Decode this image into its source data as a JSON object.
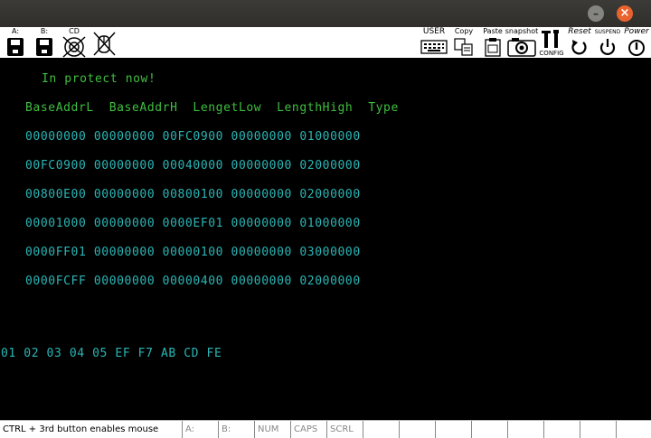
{
  "window": {
    "close_glyph": "×"
  },
  "toolbar": {
    "floppy_a": "A:",
    "floppy_b": "B:",
    "cdrom": "CD",
    "user": "USER",
    "copy": "Copy",
    "paste": "Paste",
    "snapshot": "snapshot",
    "config": "CONFIG",
    "reset": "Reset",
    "suspend": "SUSPEND",
    "power": "Power"
  },
  "screen": {
    "message": "In protect now!",
    "header": "BaseAddrL  BaseAddrH  LengetLow  LengthHigh  Type",
    "rows": [
      "00000000 00000000 00FC0900 00000000 01000000",
      "00FC0900 00000000 00040000 00000000 02000000",
      "00800E00 00000000 00800100 00000000 02000000",
      "00001000 00000000 0000EF01 00000000 01000000",
      "0000FF01 00000000 00000100 00000000 03000000",
      "0000FCFF 00000000 00000400 00000000 02000000"
    ],
    "bytes": "01 02 03 04 05 EF F7 AB CD FE"
  },
  "status": {
    "hint": "CTRL + 3rd button enables mouse",
    "a": "A:",
    "b": "B:",
    "num": "NUM",
    "caps": "CAPS",
    "scrl": "SCRL"
  }
}
